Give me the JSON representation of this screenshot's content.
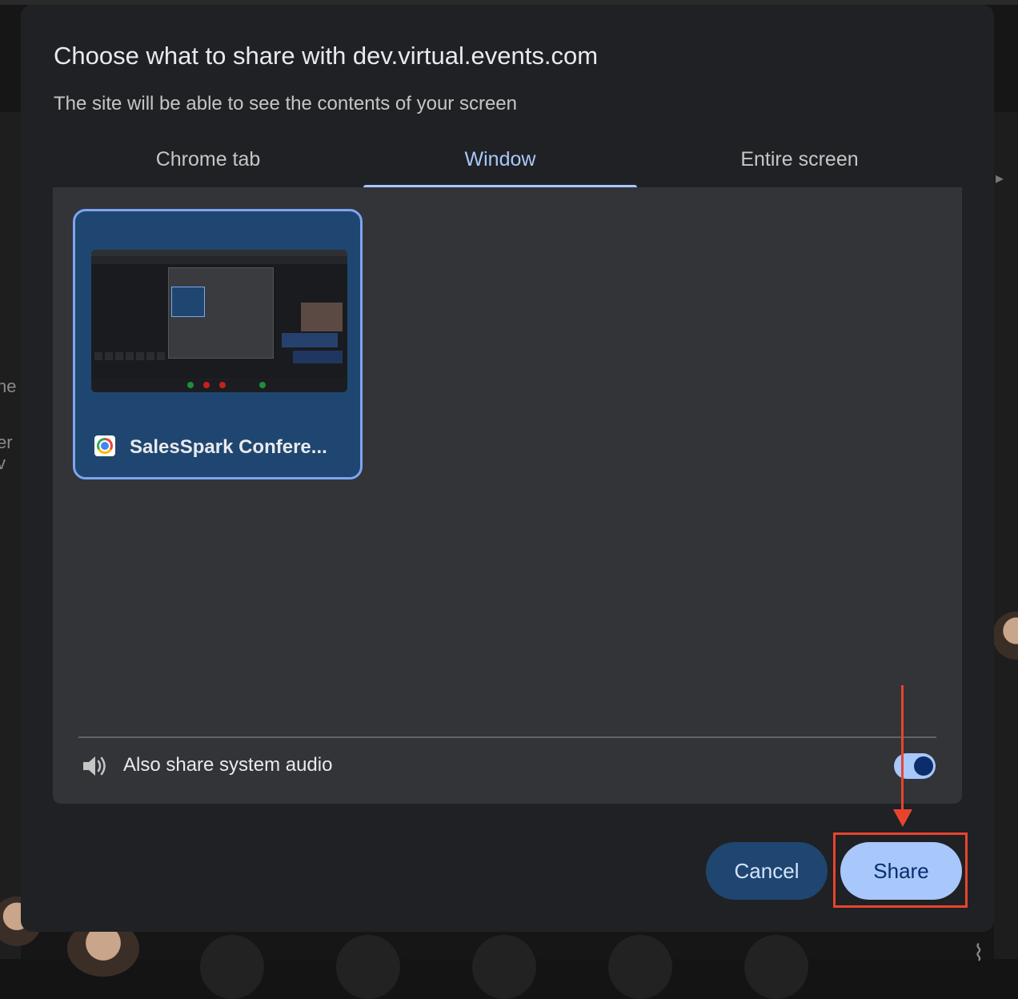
{
  "dialog": {
    "title": "Choose what to share with dev.virtual.events.com",
    "subtitle": "The site will be able to see the contents of your screen"
  },
  "tabs": [
    {
      "label": "Chrome tab",
      "active": false
    },
    {
      "label": "Window",
      "active": true
    },
    {
      "label": "Entire screen",
      "active": false
    }
  ],
  "sources": [
    {
      "label": "SalesSpark Confere...",
      "icon": "chrome-icon",
      "selected": true
    }
  ],
  "audio": {
    "label": "Also share system audio",
    "enabled": true
  },
  "buttons": {
    "cancel_label": "Cancel",
    "share_label": "Share"
  },
  "background": {
    "left_text_1": "ne",
    "left_text_2": "er v"
  },
  "colors": {
    "dialog_bg": "#202124",
    "panel_bg": "#333438",
    "accent": "#a8c7fa",
    "selected_card": "#1f4670",
    "annotation": "#e8442d"
  }
}
